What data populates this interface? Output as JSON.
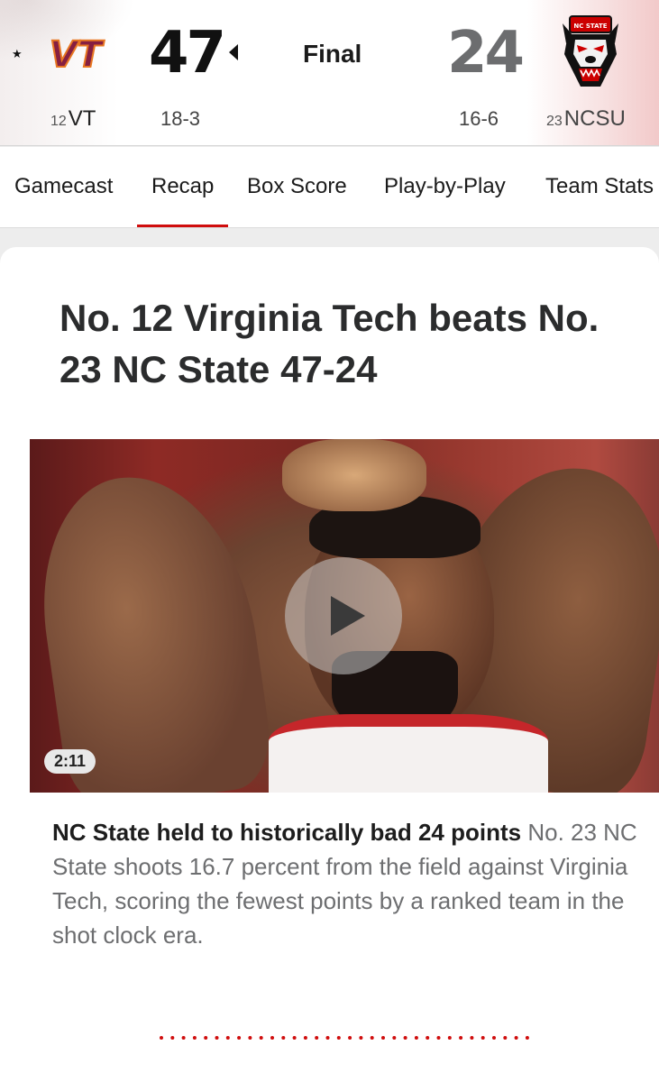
{
  "scoreboard": {
    "status": "Final",
    "home": {
      "abbr": "VT",
      "rank": "12",
      "score": "47",
      "record": "18-3",
      "logo_text": "VT",
      "favorite_icon": "star-icon",
      "winner_indicator": "arrow-left-icon",
      "color": "#861f41"
    },
    "away": {
      "abbr": "NCSU",
      "rank": "23",
      "score": "24",
      "record": "16-6",
      "logo_text": "NC STATE",
      "logo_icon": "wolf-mascot-icon",
      "color": "#cc0000"
    }
  },
  "tabs": [
    {
      "label": "Gamecast",
      "active": false
    },
    {
      "label": "Recap",
      "active": true
    },
    {
      "label": "Box Score",
      "active": false
    },
    {
      "label": "Play-by-Play",
      "active": false
    },
    {
      "label": "Team Stats",
      "active": false
    }
  ],
  "article": {
    "headline": "No. 12 Virginia Tech beats No. 23 NC State 47-24",
    "video": {
      "duration": "2:11",
      "play_icon": "play-icon"
    },
    "story_title": "NC State held to historically bad 24 points",
    "story_text": "No. 23 NC State shoots 16.7 percent from the field against Virginia Tech, scoring the fewest points by a ranked team in the shot clock era."
  },
  "colors": {
    "accent": "#d00d0d",
    "text_primary": "#1b1b1b",
    "text_secondary": "#6d6e70"
  }
}
